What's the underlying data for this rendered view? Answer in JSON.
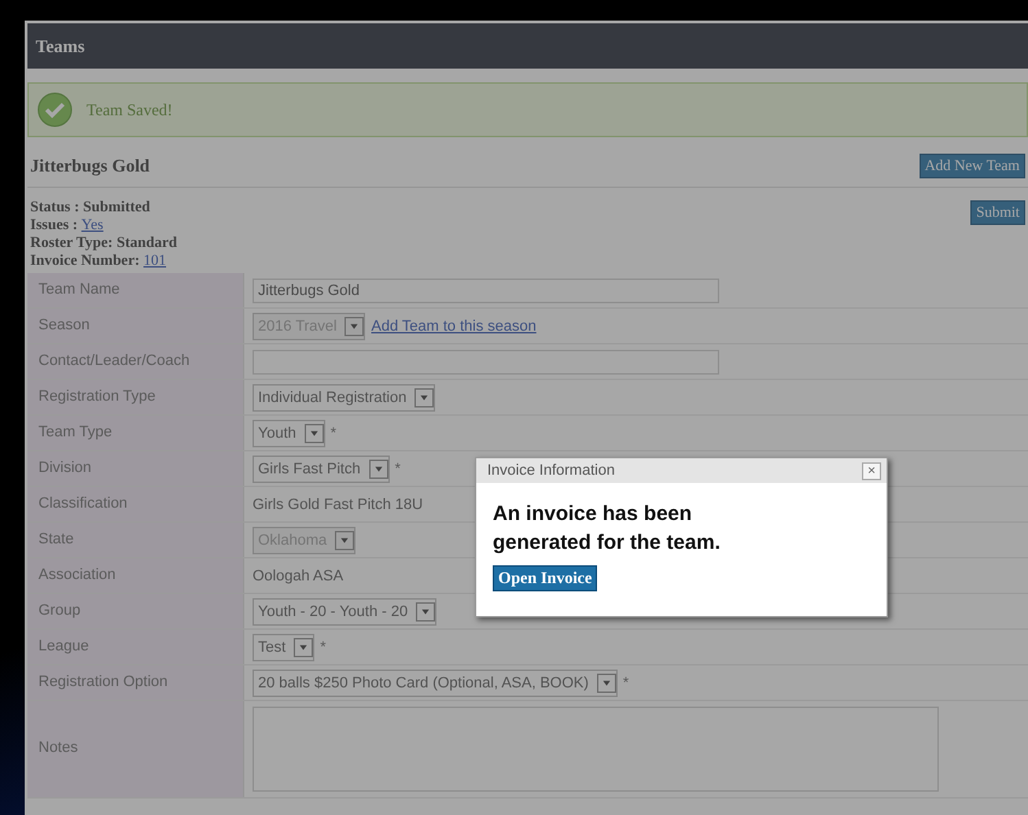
{
  "header": {
    "title": "Teams"
  },
  "notice": {
    "kind": "success",
    "text": "Team Saved!"
  },
  "team": {
    "name": "Jitterbugs Gold",
    "add_button": "Add New Team",
    "submit_button": "Submit"
  },
  "info": [
    {
      "label": "Status : ",
      "value": "Submitted",
      "link": false
    },
    {
      "label": "Issues : ",
      "value": "Yes",
      "link": true
    },
    {
      "label": "Roster Type: ",
      "value": "Standard",
      "link": false
    },
    {
      "label": "Invoice Number: ",
      "value": "101",
      "link": true
    }
  ],
  "form": [
    {
      "label": "Team Name",
      "kind": "input",
      "value": "Jitterbugs Gold"
    },
    {
      "label": "Season",
      "kind": "select",
      "value": "2016 Travel",
      "disabled": true,
      "link": "Add Team to this season"
    },
    {
      "label": "Contact/Leader/Coach",
      "kind": "input"
    },
    {
      "label": "Registration Type",
      "kind": "select",
      "value": "Individual Registration",
      "disabled": false
    },
    {
      "label": "Team Type",
      "kind": "select",
      "value": "Youth",
      "disabled": false,
      "suffix": "*"
    },
    {
      "label": "Division",
      "kind": "select",
      "value": "Girls Fast Pitch",
      "disabled": false,
      "suffix": "*"
    },
    {
      "label": "Classification",
      "kind": "text",
      "value": "Girls Gold Fast Pitch 18U"
    },
    {
      "label": "State",
      "kind": "select",
      "value": "Oklahoma",
      "disabled": true
    },
    {
      "label": "Association",
      "kind": "text",
      "value": "Oologah ASA"
    },
    {
      "label": "Group",
      "kind": "select",
      "value": "Youth - 20 - Youth - 20",
      "disabled": false
    },
    {
      "label": "League",
      "kind": "select",
      "value": "Test",
      "disabled": false,
      "suffix": "*"
    },
    {
      "label": "Registration Option",
      "kind": "select",
      "value": "20 balls $250 Photo Card (Optional, ASA, BOOK)",
      "disabled": false,
      "suffix": "*"
    },
    {
      "label": "Notes",
      "kind": "textarea"
    }
  ],
  "dialog": {
    "title": "Invoice Information",
    "close": "×",
    "message": "An invoice has been generated for the team.",
    "button": "Open Invoice"
  }
}
